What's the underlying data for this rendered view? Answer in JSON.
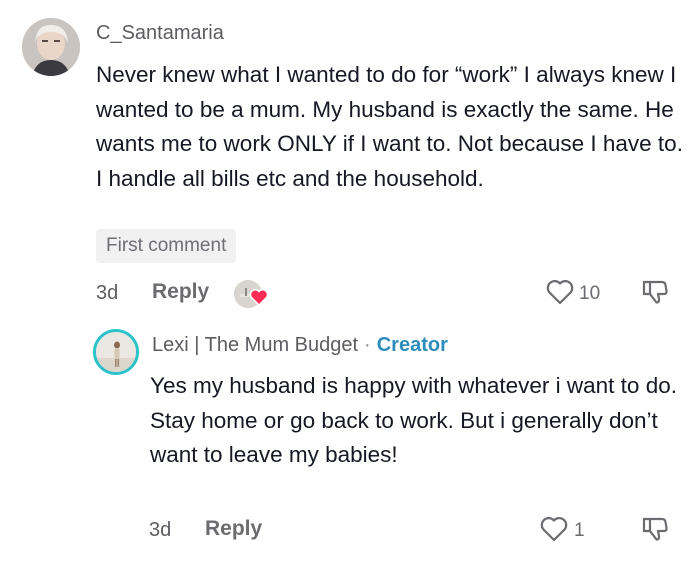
{
  "comment": {
    "username": "C_Santamaria",
    "text": "Never knew what I wanted to do for “work” I always knew I wanted to be a mum. My husband is exactly the same. He wants me to work ONLY if I want to. Not because I have to. I handle all bills etc and the household.",
    "badge": "First comment",
    "time": "3d",
    "reply_label": "Reply",
    "likes": "10"
  },
  "reply": {
    "username": "Lexi | The Mum Budget",
    "separator": "·",
    "role": "Creator",
    "text": "Yes my husband is happy with whatever i want to do. Stay home or go back to work. But i generally don’t want to leave my babies!",
    "time": "3d",
    "reply_label": "Reply",
    "likes": "1"
  },
  "colors": {
    "creator": "#2c8dbd",
    "avatar_ring": "#2dc2c9",
    "liked_heart": "#fe2c55"
  }
}
